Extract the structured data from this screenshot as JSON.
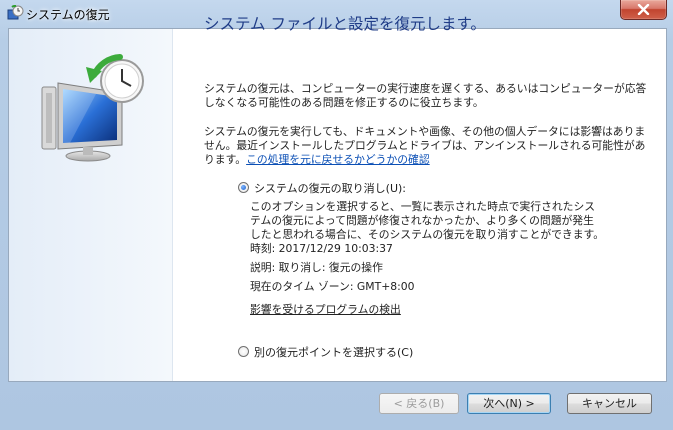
{
  "window": {
    "title": "システムの復元"
  },
  "main": {
    "heading": "システム ファイルと設定を復元します。",
    "para1_line1": "システムの復元は、コンピューターの実行速度を遅くする、あるいはコンピューターが応答",
    "para1_line2": "しなくなる可能性のある問題を修正するのに役立ちます。",
    "para2_line1": "システムの復元を実行しても、ドキュメントや画像、その他の個人データには影響はありま",
    "para2_line2": "せん。最近インストールしたプログラムとドライブは、アンインストールされる可能性があ",
    "para2_line3_prefix": "ります。",
    "para2_link": "この処理を元に戻せるかどうかの確認"
  },
  "options": {
    "undo": {
      "label": "システムの復元の取り消し(U):",
      "selected": true,
      "desc_line1": "このオプションを選択すると、一覧に表示された時点で実行されたシス",
      "desc_line2": "テムの復元によって問題が修復されなかったか、より多くの問題が発生",
      "desc_line3": "したと思われる場合に、そのシステムの復元を取り消すことができます。",
      "time": "時刻: 2017/12/29 10:03:37",
      "description": "説明: 取り消し: 復元の操作",
      "timezone": "現在のタイム ゾーン: GMT+8:00",
      "scan_link": "影響を受けるプログラムの検出"
    },
    "other": {
      "label": "別の復元ポイントを選択する(C)",
      "selected": false
    }
  },
  "buttons": {
    "back": "< 戻る(B)",
    "next": "次へ(N) >",
    "cancel": "キャンセル"
  },
  "colors": {
    "heading": "#1f3c87",
    "link": "#0b4fb5",
    "frame": "#b9d1ea"
  }
}
